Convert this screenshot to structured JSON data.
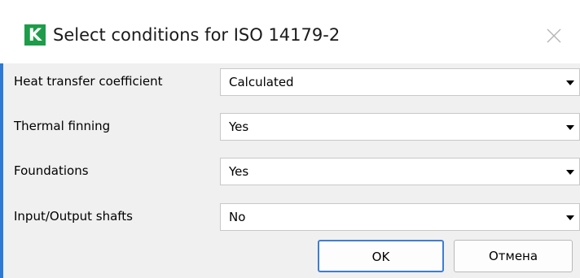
{
  "window": {
    "icon_letter": "K",
    "title": "Select conditions for ISO 14179-2",
    "close_icon": "close-icon"
  },
  "colors": {
    "icon_green": "#1e9c4a",
    "focus_blue": "#3f7ecf",
    "dialog_bg": "#f0f0f0"
  },
  "rows": [
    {
      "label": "Heat transfer coefficient",
      "value": "Calculated"
    },
    {
      "label": "Thermal finning",
      "value": "Yes"
    },
    {
      "label": "Foundations",
      "value": "Yes"
    },
    {
      "label": "Input/Output shafts",
      "value": "No"
    }
  ],
  "buttons": {
    "ok_label": "OK",
    "cancel_label": "Отмена"
  }
}
